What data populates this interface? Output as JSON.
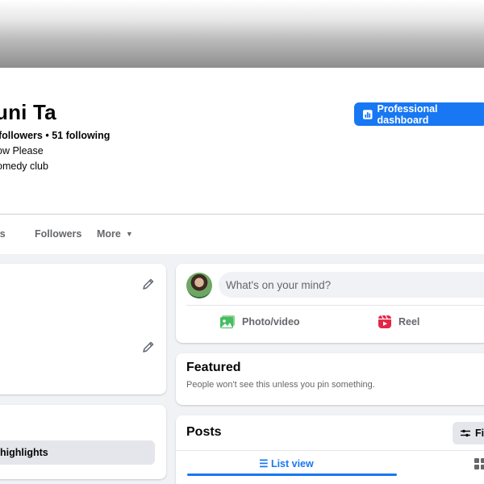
{
  "profile": {
    "name": "uni Ta",
    "follow_counts": "followers • 51 following",
    "line2": "ow Please",
    "line3": "omedy club"
  },
  "header": {
    "professional_dashboard_label": "Professional dashboard"
  },
  "tabs": {
    "photos": "tos",
    "followers": "Followers",
    "more": "More"
  },
  "intro": {
    "text": ")"
  },
  "left_card2": {
    "highlights_label": "highlights"
  },
  "composer": {
    "placeholder": "What's on your mind?",
    "photo_video_label": "Photo/video",
    "reel_label": "Reel"
  },
  "featured": {
    "title": "Featured",
    "subtitle": "People won't see this unless you pin something."
  },
  "posts": {
    "title": "Posts",
    "filter_label": "Fil",
    "list_view_label": "List view"
  },
  "colors": {
    "accent": "#1877f2",
    "background": "#f0f2f5"
  },
  "icons": [
    "chart-icon",
    "pencil-icon",
    "photo-icon",
    "reel-icon",
    "filter-icon",
    "list-icon",
    "grid-icon",
    "caret-down-icon"
  ]
}
